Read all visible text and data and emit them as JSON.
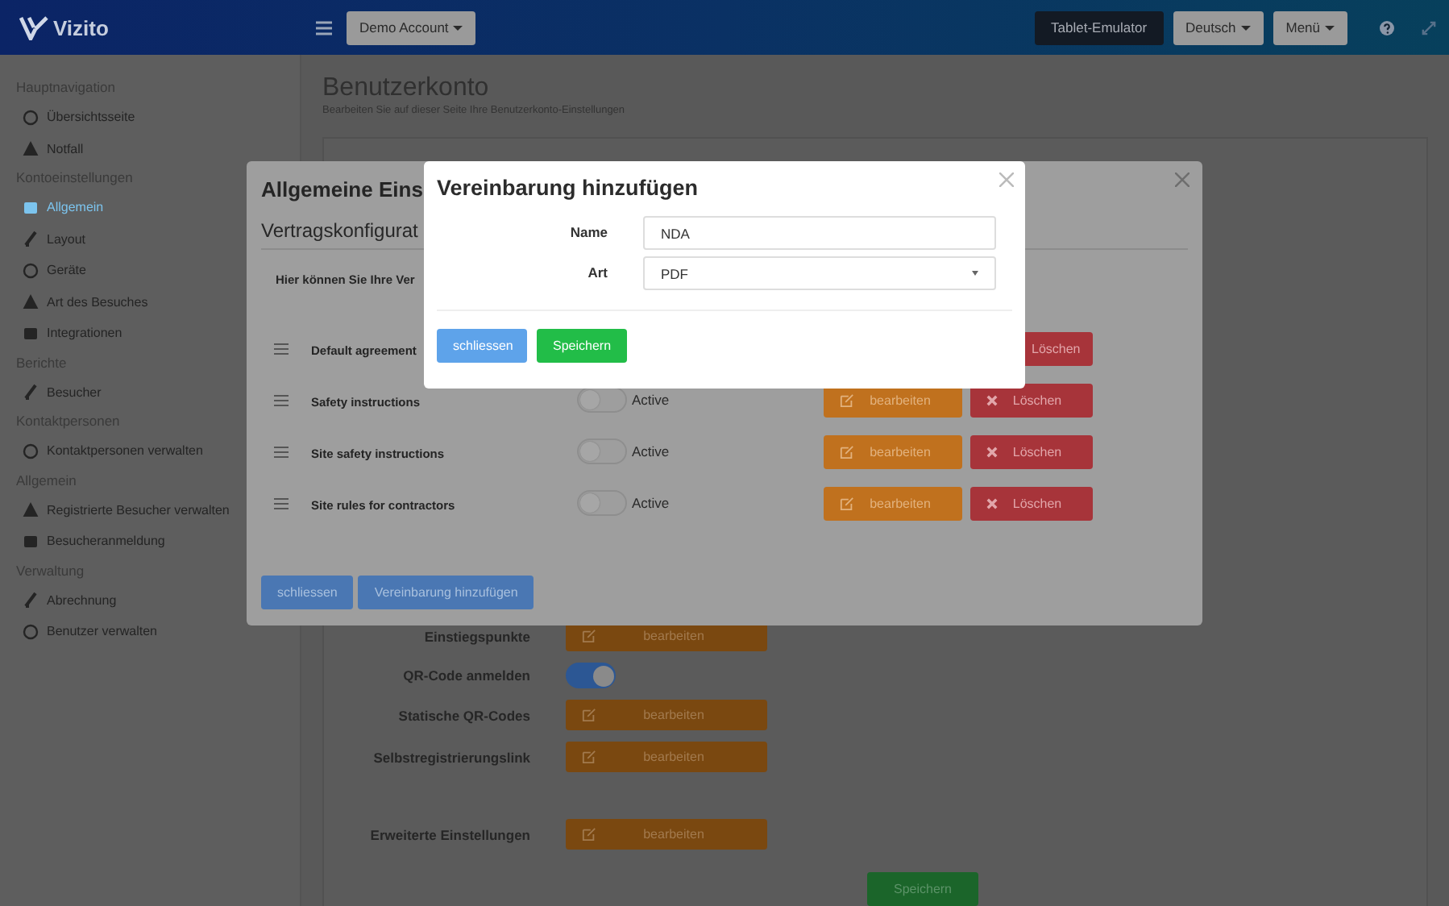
{
  "topbar": {
    "logo": "Vizito",
    "account_button": "Demo Account",
    "buttons": [
      {
        "label": "Tablet-Emulator",
        "kind": "dark"
      },
      {
        "label": "Deutsch",
        "kind": "dropdown"
      },
      {
        "label": "Menü",
        "kind": "dropdown"
      }
    ]
  },
  "sidebar": {
    "sections": [
      {
        "heading": "Hauptnavigation",
        "items": [
          {
            "label": "Übersichtsseite",
            "selected": false
          },
          {
            "label": "Notfall",
            "selected": false
          }
        ]
      },
      {
        "heading": "Kontoeinstellungen",
        "items": [
          {
            "label": "Allgemein",
            "selected": true
          },
          {
            "label": "Layout",
            "selected": false
          },
          {
            "label": "Geräte",
            "selected": false
          },
          {
            "label": "Art des Besuches",
            "selected": false
          },
          {
            "label": "Integrationen",
            "selected": false
          }
        ]
      },
      {
        "heading": "Berichte",
        "items": [
          {
            "label": "Besucher",
            "selected": false
          }
        ]
      },
      {
        "heading": "Kontaktpersonen",
        "items": [
          {
            "label": "Kontaktpersonen verwalten",
            "selected": false
          }
        ]
      },
      {
        "heading": "Allgemein",
        "items": [
          {
            "label": "Registrierte Besucher verwalten",
            "selected": false
          },
          {
            "label": "Besucheranmeldung",
            "selected": false
          }
        ]
      },
      {
        "heading": "Verwaltung",
        "items": [
          {
            "label": "Abrechnung",
            "selected": false
          },
          {
            "label": "Benutzer verwalten",
            "selected": false
          }
        ]
      }
    ]
  },
  "page": {
    "title": "Benutzerkonto",
    "subtitle": "Bearbeiten Sie auf dieser Seite Ihre Benutzerkonto-Einstellungen"
  },
  "settings": [
    {
      "label": "Einstiegspunkte",
      "kind": "button",
      "button": "bearbeiten"
    },
    {
      "label": "QR-Code anmelden",
      "kind": "toggle",
      "on": true
    },
    {
      "label": "Statische QR-Codes",
      "kind": "button",
      "button": "bearbeiten"
    },
    {
      "label": "Selbstregistrierungslink",
      "kind": "button",
      "button": "bearbeiten"
    },
    {
      "label": "Erweiterte Einstellungen",
      "kind": "button",
      "button": "bearbeiten",
      "spaced": true
    }
  ],
  "save_button": "Speichern",
  "contract_dialog": {
    "title": "Allgemeine Eins",
    "subtitle": "Vertragskonfigurat",
    "intro": "Hier können Sie Ihre Ver",
    "agreements": [
      {
        "name": "Default agreement",
        "delete": "Löschen"
      },
      {
        "name": "Safety instructions",
        "on": false,
        "status": "Active",
        "edit": "bearbeiten",
        "delete": "Löschen"
      },
      {
        "name": "Site safety instructions",
        "on": false,
        "status": "Active",
        "edit": "bearbeiten",
        "delete": "Löschen"
      },
      {
        "name": "Site rules for contractors",
        "on": false,
        "status": "Active",
        "edit": "bearbeiten",
        "delete": "Löschen"
      }
    ],
    "buttons": [
      "schliessen",
      "Vereinbarung hinzufügen"
    ]
  },
  "add_dialog": {
    "title": "Vereinbarung hinzufügen",
    "fields": [
      {
        "label": "Name",
        "kind": "text",
        "value": "NDA"
      },
      {
        "label": "Art",
        "kind": "select",
        "value": "PDF"
      }
    ],
    "buttons": [
      {
        "label": "schliessen",
        "kind": "secondary"
      },
      {
        "label": "Speichern",
        "kind": "primary"
      }
    ]
  }
}
